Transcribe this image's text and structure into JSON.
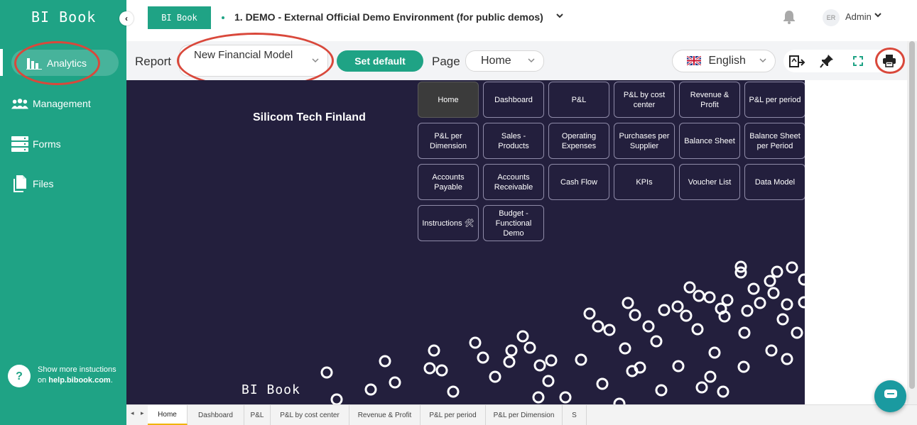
{
  "sidebar": {
    "logo": "BI Book",
    "items": [
      {
        "label": "Analytics",
        "icon": "bar-chart-icon",
        "active": true
      },
      {
        "label": "Management",
        "icon": "users-icon"
      },
      {
        "label": "Forms",
        "icon": "server-icon"
      },
      {
        "label": "Files",
        "icon": "files-icon"
      }
    ],
    "help_line1": "Show more instuctions",
    "help_on": "on ",
    "help_link": "help.bibook.com",
    "help_end": "."
  },
  "header": {
    "tag": "BI Book",
    "environment": "1. DEMO - External Official Demo Environment (for public demos)",
    "avatar_initials": "ER",
    "user": "Admin"
  },
  "toolbar": {
    "report_label": "Report",
    "report_value": "New Financial Model",
    "set_default": "Set default",
    "page_label": "Page",
    "page_value": "Home",
    "language": "English"
  },
  "report": {
    "company": "Silicom Tech Finland",
    "logo": "BI Book",
    "tiles": [
      "Home",
      "Dashboard",
      "P&L",
      "P&L by cost center",
      "Revenue & Profit",
      "P&L per period",
      "P&L per Dimension",
      "Sales - Products",
      "Operating Expenses",
      "Purchases per Supplier",
      "Balance Sheet",
      "Balance Sheet per Period",
      "Accounts Payable",
      "Accounts Receivable",
      "Cash Flow",
      "KPIs",
      "Voucher List",
      "Data Model",
      "Instructions 🛠",
      "Budget - Functional Demo"
    ]
  },
  "sheet_tabs": [
    "Home",
    "Dashboard",
    "P&L",
    "P&L by cost center",
    "Revenue & Profit",
    "P&L per period",
    "P&L per Dimension",
    "S"
  ],
  "colors": {
    "brand": "#1fa385",
    "canvas": "#231f3d",
    "highlight": "#d9483b"
  }
}
